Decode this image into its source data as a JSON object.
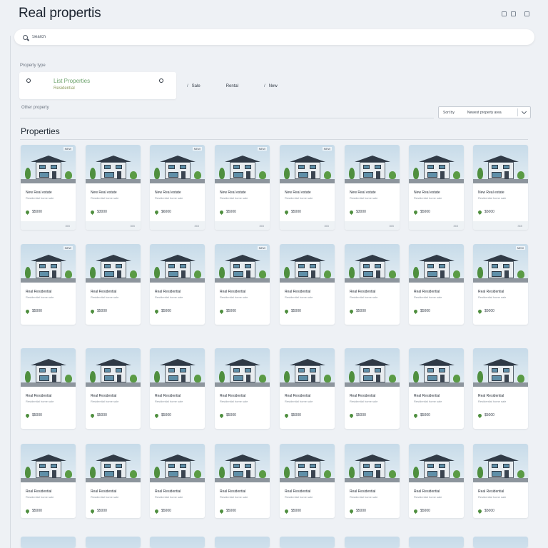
{
  "app": {
    "title": "Real propertis"
  },
  "search": {
    "value": "Search"
  },
  "property_type": {
    "label": "Property type",
    "selected_title": "List Properties",
    "selected_sub": "Residential",
    "tabs": [
      {
        "label": "Sale"
      },
      {
        "label": "Rental"
      },
      {
        "label": "New"
      }
    ]
  },
  "filter": {
    "label": "Other property"
  },
  "sort": {
    "label": "Sort by",
    "value": "Newest property area"
  },
  "section": {
    "title": "Properties"
  },
  "cards": [
    {
      "tag": "NEW",
      "title": "New Real estate",
      "sub": "Residential home sale",
      "price": "$5000",
      "foot_a": "",
      "foot_b": "365"
    },
    {
      "tag": "",
      "title": "New Real estate",
      "sub": "Residential home sale",
      "price": "$3000",
      "foot_a": "",
      "foot_b": "365"
    },
    {
      "tag": "NEW",
      "title": "New Real estate",
      "sub": "Residential home sale",
      "price": "$6000",
      "foot_a": "",
      "foot_b": "365"
    },
    {
      "tag": "NEW",
      "title": "New Real estate",
      "sub": "Residential home sale",
      "price": "$5000",
      "foot_a": "",
      "foot_b": "365"
    },
    {
      "tag": "NEW",
      "title": "New Real estate",
      "sub": "Residential home sale",
      "price": "$5000",
      "foot_a": "",
      "foot_b": "365"
    },
    {
      "tag": "",
      "title": "New Real estate",
      "sub": "Residential home sale",
      "price": "$3000",
      "foot_a": "",
      "foot_b": "365"
    },
    {
      "tag": "",
      "title": "New Real estate",
      "sub": "Residential home sale",
      "price": "$5000",
      "foot_a": "",
      "foot_b": "365"
    },
    {
      "tag": "",
      "title": "New Real estate",
      "sub": "Residential home sale",
      "price": "$5000",
      "foot_a": "",
      "foot_b": "365"
    },
    {
      "tag": "NEW",
      "title": "Real Residential",
      "sub": "Residential home sale",
      "price": "$5000"
    },
    {
      "tag": "",
      "title": "Real Residential",
      "sub": "Residential home sale",
      "price": "$5000"
    },
    {
      "tag": "",
      "title": "Real Residential",
      "sub": "Residential home sale",
      "price": "$5000"
    },
    {
      "tag": "NEW",
      "title": "Real Residential",
      "sub": "Residential home sale",
      "price": "$5000"
    },
    {
      "tag": "",
      "title": "Real Residential",
      "sub": "Residential home sale",
      "price": "$5000"
    },
    {
      "tag": "",
      "title": "Real Residential",
      "sub": "Residential home sale",
      "price": "$5000"
    },
    {
      "tag": "",
      "title": "Real Residential",
      "sub": "Residential home sale",
      "price": "$5000"
    },
    {
      "tag": "NEW",
      "title": "Real Residential",
      "sub": "Residential home sale",
      "price": "$5000"
    },
    {
      "tag": "",
      "title": "Real Residential",
      "sub": "Residential home sale",
      "price": "$5000"
    },
    {
      "tag": "",
      "title": "Real Residential",
      "sub": "Residential home sale",
      "price": "$5000"
    },
    {
      "tag": "",
      "title": "Real Residential",
      "sub": "Residential home sale",
      "price": "$5000"
    },
    {
      "tag": "",
      "title": "Real Residential",
      "sub": "Residential home sale",
      "price": "$5000"
    },
    {
      "tag": "",
      "title": "Real Residential",
      "sub": "Residential home sale",
      "price": "$5000"
    },
    {
      "tag": "",
      "title": "Real Residential",
      "sub": "Residential home sale",
      "price": "$5000"
    },
    {
      "tag": "",
      "title": "Real Residential",
      "sub": "Residential home sale",
      "price": "$5000"
    },
    {
      "tag": "",
      "title": "Real Residential",
      "sub": "Residential home sale",
      "price": "$5000"
    },
    {
      "tag": "",
      "title": "Real Residential",
      "sub": "Residential home sale",
      "price": "$5000"
    },
    {
      "tag": "",
      "title": "Real Residential",
      "sub": "Residential home sale",
      "price": "$5000"
    },
    {
      "tag": "",
      "title": "Real Residential",
      "sub": "Residential home sale",
      "price": "$5000"
    },
    {
      "tag": "",
      "title": "Real Residential",
      "sub": "Residential home sale",
      "price": "$5000"
    },
    {
      "tag": "",
      "title": "Real Residential",
      "sub": "Residential home sale",
      "price": "$5000"
    },
    {
      "tag": "",
      "title": "Real Residential",
      "sub": "Residential home sale",
      "price": "$5000"
    },
    {
      "tag": "",
      "title": "Real Residential",
      "sub": "Residential home sale",
      "price": "$5000"
    },
    {
      "tag": "",
      "title": "Real Residential",
      "sub": "Residential home sale",
      "price": "$5000"
    }
  ]
}
